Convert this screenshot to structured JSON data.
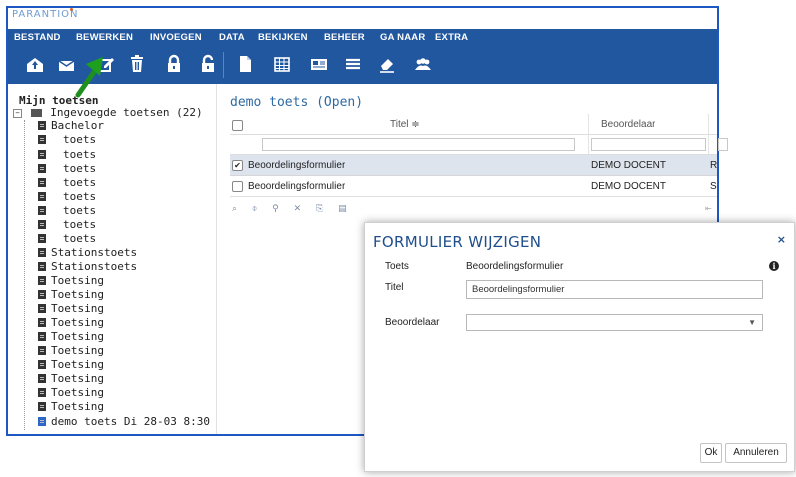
{
  "app": {
    "logo": "PARANTION"
  },
  "menu": [
    "BESTAND",
    "BEWERKEN",
    "INVOEGEN",
    "DATA",
    "BEKIJKEN",
    "BEHEER",
    "GA NAAR",
    "EXTRA"
  ],
  "toolbar_icons": [
    "inbox-upload-icon",
    "mail-send-icon",
    "edit-icon",
    "trash-icon",
    "lock-icon",
    "unlock-icon",
    "document-icon",
    "table-icon",
    "newspaper-icon",
    "list-icon",
    "eraser-icon",
    "users-icon"
  ],
  "sidebar": {
    "title": "Mijn toetsen",
    "root": "Ingevoegde toetsen (22)",
    "items": [
      "Bachelor",
      "toets",
      "toets",
      "toets",
      "toets",
      "toets",
      "toets",
      "toets",
      "toets",
      "Stationstoets",
      "Stationstoets",
      "Toetsing",
      "Toetsing",
      "Toetsing",
      "Toetsing",
      "Toetsing",
      "Toetsing",
      "Toetsing",
      "Toetsing",
      "Toetsing",
      "Toetsing",
      "demo toets Di 28-03 8:30"
    ]
  },
  "grid": {
    "title": "demo toets (Open)",
    "headers": {
      "titel": "Titel ≑",
      "beoordelaar": "Beoordelaar"
    },
    "rows": [
      {
        "checked": true,
        "titel": "Beoordelingsformulier",
        "beoordelaar": "DEMO DOCENT",
        "extra": "R"
      },
      {
        "checked": false,
        "titel": "Beoordelingsformulier",
        "beoordelaar": "DEMO DOCENT",
        "extra": "S"
      }
    ],
    "tools": "⌕ ⌽ ⚲ ✕ ⎘ ▤",
    "pager": "⇤"
  },
  "dialog": {
    "title": "FORMULIER WIJZIGEN",
    "close": "×",
    "toets_label": "Toets",
    "toets_value": "Beoordelingsformulier",
    "titel_label": "Titel",
    "titel_value": "Beoordelingsformulier",
    "beoordelaar_label": "Beoordelaar",
    "beoordelaar_value": "",
    "ok": "Ok",
    "cancel": "Annuleren"
  },
  "colors": {
    "menubar": "#21579f",
    "accent": "#1e57c2",
    "selected_row": "#dde4ee",
    "arrow": "#1ea01e"
  }
}
